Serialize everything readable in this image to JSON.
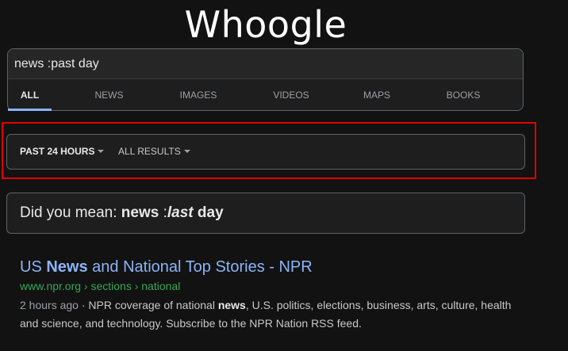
{
  "logo": "Whoogle",
  "search": {
    "value": "news :past day"
  },
  "tabs": [
    {
      "label": "ALL",
      "active": true
    },
    {
      "label": "NEWS",
      "active": false
    },
    {
      "label": "IMAGES",
      "active": false
    },
    {
      "label": "VIDEOS",
      "active": false
    },
    {
      "label": "MAPS",
      "active": false
    },
    {
      "label": "BOOKS",
      "active": false
    }
  ],
  "filters": {
    "time": "PAST 24 HOURS",
    "results": "ALL RESULTS"
  },
  "did_you_mean": {
    "prefix": "Did you mean:",
    "word1": "news",
    "sep": " :",
    "word2": "last",
    "word3": "day"
  },
  "result": {
    "title_pre": "US ",
    "title_bold": "News",
    "title_post": " and National Top Stories - NPR",
    "url": "www.npr.org › sections › national",
    "time": "2 hours ago",
    "snippet_pre": " · NPR coverage of national ",
    "snippet_bold": "news",
    "snippet_post": ", U.S. politics, elections, business, arts, culture, health and science, and technology. Subscribe to the NPR Nation RSS feed."
  },
  "colors": {
    "background": "#121212",
    "link": "#8ab4f8",
    "url": "#34a853",
    "highlight": "#e00000"
  }
}
